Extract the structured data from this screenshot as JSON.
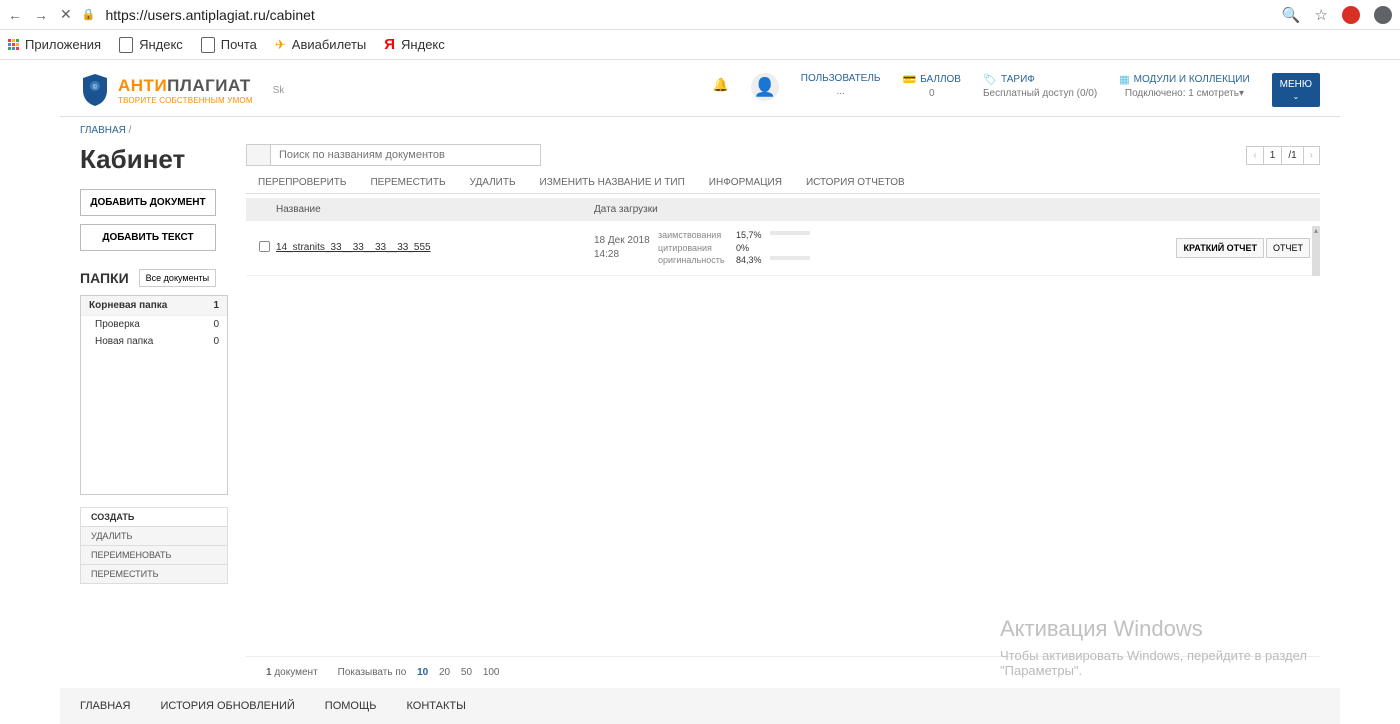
{
  "browser": {
    "url": "https://users.antiplagiat.ru/cabinet",
    "bookmarks": {
      "apps": "Приложения",
      "yandex1": "Яндекс",
      "mail": "Почта",
      "avia": "Авиабилеты",
      "yandex2": "Яндекс"
    }
  },
  "logo": {
    "anti": "АНТИ",
    "plag": "ПЛАГИАТ",
    "tagline": "ТВОРИТЕ СОБСТВЕННЫМ УМОМ",
    "sk": "Sk"
  },
  "header": {
    "user_label": "ПОЛЬЗОВАТЕЛЬ",
    "user_value": "...",
    "points_label": "БАЛЛОВ",
    "points_value": "0",
    "tariff_label": "ТАРИФ",
    "tariff_value": "Бесплатный доступ (0/0)",
    "modules_label": "МОДУЛИ И КОЛЛЕКЦИИ",
    "modules_value": "Подключено: 1 смотреть▾",
    "menu": "МЕНЮ",
    "menu_arrow": "⌄"
  },
  "breadcrumb": {
    "home": "ГЛАВНАЯ",
    "sep": "/"
  },
  "sidebar": {
    "title": "Кабинет",
    "add_doc": "ДОБАВИТЬ ДОКУМЕНТ",
    "add_text": "ДОБАВИТЬ ТЕКСТ",
    "folders_title": "ПАПКИ",
    "all_docs": "Все документы",
    "root": {
      "name": "Корневая папка",
      "count": "1"
    },
    "items": [
      {
        "name": "Проверка",
        "count": "0"
      },
      {
        "name": "Новая папка",
        "count": "0"
      }
    ],
    "actions": {
      "create": "СОЗДАТЬ",
      "delete": "УДАЛИТЬ",
      "rename": "ПЕРЕИМЕНОВАТЬ",
      "move": "ПЕРЕМЕСТИТЬ"
    }
  },
  "main": {
    "search_placeholder": "Поиск по названиям документов",
    "page_current": "1",
    "page_total": "/1",
    "tabs": {
      "recheck": "ПЕРЕПРОВЕРИТЬ",
      "move": "ПЕРЕМЕСТИТЬ",
      "delete": "УДАЛИТЬ",
      "rename": "ИЗМЕНИТЬ НАЗВАНИЕ И ТИП",
      "info": "ИНФОРМАЦИЯ",
      "history": "ИСТОРИЯ ОТЧЕТОВ"
    },
    "columns": {
      "name": "Название",
      "date": "Дата загрузки"
    },
    "row": {
      "name": "14_stranits_33__33__33__33_555",
      "date1": "18 Дек 2018",
      "date2": "14:28",
      "borrowing_label": "заимствования",
      "borrowing_val": "15,7%",
      "citation_label": "цитирования",
      "citation_val": "0%",
      "originality_label": "оригинальность",
      "originality_val": "84,3%",
      "short_report": "КРАТКИЙ ОТЧЕТ",
      "report": "ОТЧЕТ"
    }
  },
  "bottom": {
    "doc_count_num": "1",
    "doc_count": " документ",
    "show_by": "Показывать по",
    "sizes": [
      "10",
      "20",
      "50",
      "100"
    ]
  },
  "footer": {
    "home": "ГЛАВНАЯ",
    "updates": "ИСТОРИЯ ОБНОВЛЕНИЙ",
    "help": "ПОМОЩЬ",
    "contacts": "КОНТАКТЫ"
  },
  "watermark": {
    "title": "Активация Windows",
    "text": "Чтобы активировать Windows, перейдите в раздел \"Параметры\"."
  }
}
